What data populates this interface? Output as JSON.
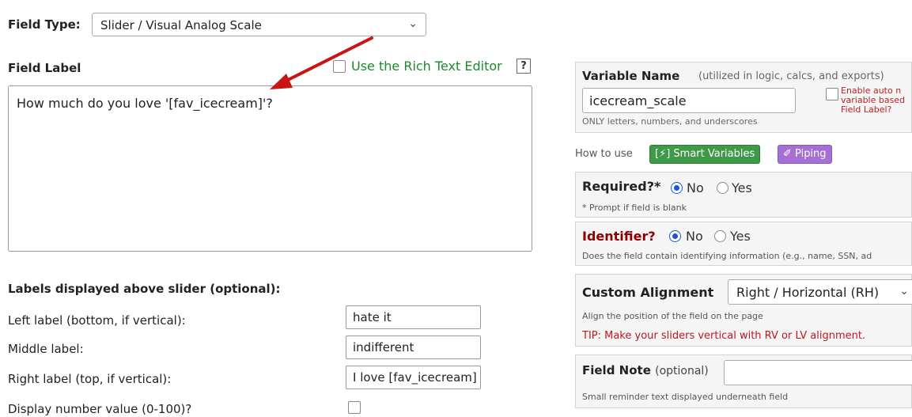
{
  "field_type": {
    "label": "Field Type:",
    "value": "Slider / Visual Analog Scale"
  },
  "field_label": {
    "label": "Field Label",
    "rich_text_label": "Use the Rich Text Editor",
    "help": "?",
    "value": "How much do you love '[fav_icecream]'?"
  },
  "slider_labels": {
    "heading": "Labels displayed above slider (optional):",
    "rows": [
      {
        "label": "Left label (bottom, if vertical):",
        "value": "hate it"
      },
      {
        "label": "Middle label:",
        "value": "indifferent"
      },
      {
        "label": "Right label (top, if vertical):",
        "value": "I love [fav_icecream]"
      }
    ],
    "display_number_label": "Display number value (0-100)?"
  },
  "variable_name": {
    "title": "Variable Name",
    "subtitle": "(utilized in logic, calcs, and exports)",
    "value": "icecream_scale",
    "hint": "ONLY letters, numbers, and underscores",
    "auto_text": "Enable auto n variable based Field Label?"
  },
  "how_to": {
    "label": "How to use",
    "smart_variables": "[⚡] Smart Variables",
    "piping": "✐ Piping"
  },
  "required": {
    "title": "Required?*",
    "no": "No",
    "yes": "Yes",
    "selected": "No",
    "note": "* Prompt if field is blank"
  },
  "identifier": {
    "title": "Identifier?",
    "no": "No",
    "yes": "Yes",
    "selected": "No",
    "note": "Does the field contain identifying information (e.g., name, SSN, ad"
  },
  "custom_alignment": {
    "title": "Custom Alignment",
    "value": "Right / Horizontal (RH)",
    "note": "Align the position of the field on the page",
    "tip": "TIP: Make your sliders vertical with RV or LV alignment."
  },
  "field_note": {
    "title": "Field Note",
    "optional": "(optional)",
    "value": "",
    "note": "Small reminder text displayed underneath field"
  },
  "colors": {
    "green_link": "#1a8a2a",
    "smart_var_bg": "#3e9a48",
    "piping_bg": "#a56fd6",
    "identifier_red": "#8b0000",
    "tip_red": "#c0181e",
    "arrow_red": "#c81414"
  }
}
